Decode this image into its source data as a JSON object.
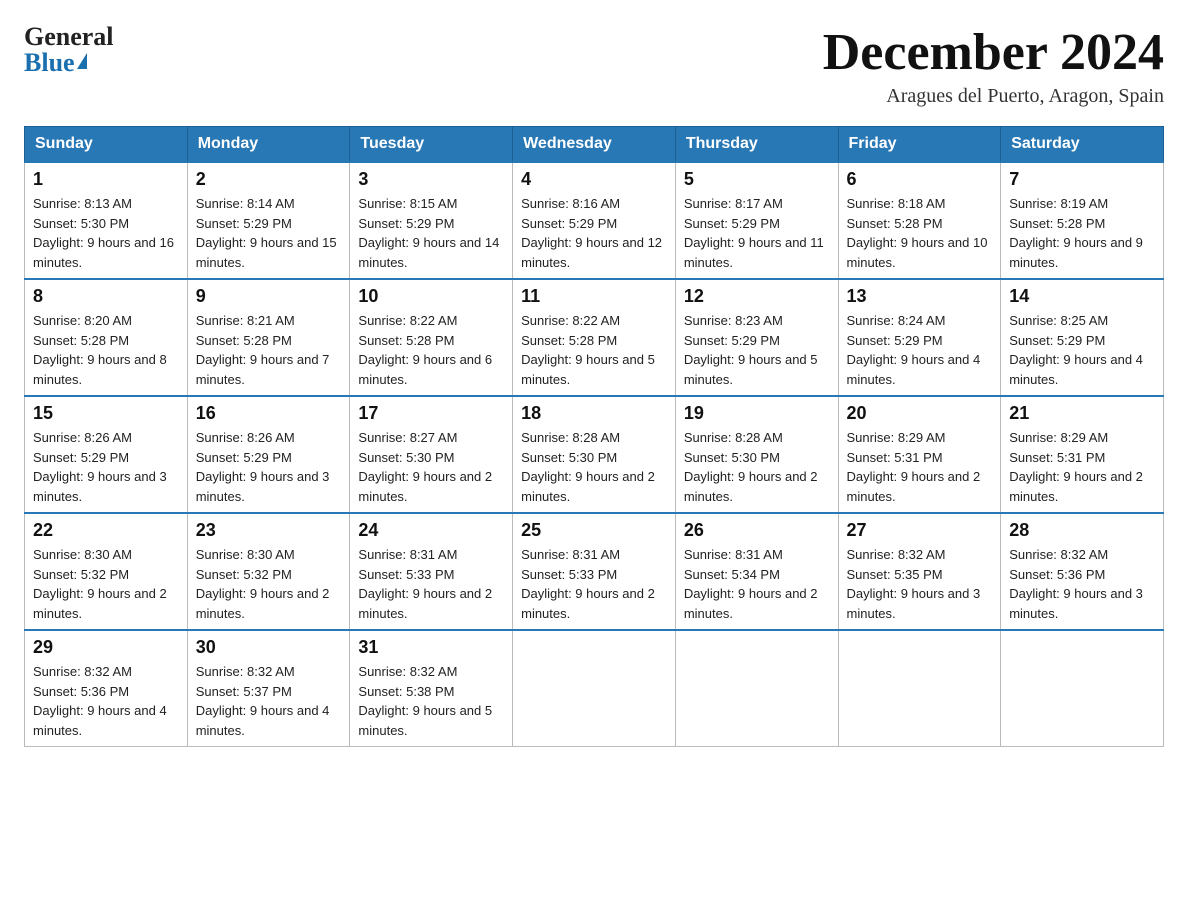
{
  "logo": {
    "general": "General",
    "blue": "Blue"
  },
  "title": {
    "month": "December 2024",
    "location": "Aragues del Puerto, Aragon, Spain"
  },
  "days_of_week": [
    "Sunday",
    "Monday",
    "Tuesday",
    "Wednesday",
    "Thursday",
    "Friday",
    "Saturday"
  ],
  "weeks": [
    [
      {
        "day": "1",
        "sunrise": "8:13 AM",
        "sunset": "5:30 PM",
        "daylight": "9 hours and 16 minutes."
      },
      {
        "day": "2",
        "sunrise": "8:14 AM",
        "sunset": "5:29 PM",
        "daylight": "9 hours and 15 minutes."
      },
      {
        "day": "3",
        "sunrise": "8:15 AM",
        "sunset": "5:29 PM",
        "daylight": "9 hours and 14 minutes."
      },
      {
        "day": "4",
        "sunrise": "8:16 AM",
        "sunset": "5:29 PM",
        "daylight": "9 hours and 12 minutes."
      },
      {
        "day": "5",
        "sunrise": "8:17 AM",
        "sunset": "5:29 PM",
        "daylight": "9 hours and 11 minutes."
      },
      {
        "day": "6",
        "sunrise": "8:18 AM",
        "sunset": "5:28 PM",
        "daylight": "9 hours and 10 minutes."
      },
      {
        "day": "7",
        "sunrise": "8:19 AM",
        "sunset": "5:28 PM",
        "daylight": "9 hours and 9 minutes."
      }
    ],
    [
      {
        "day": "8",
        "sunrise": "8:20 AM",
        "sunset": "5:28 PM",
        "daylight": "9 hours and 8 minutes."
      },
      {
        "day": "9",
        "sunrise": "8:21 AM",
        "sunset": "5:28 PM",
        "daylight": "9 hours and 7 minutes."
      },
      {
        "day": "10",
        "sunrise": "8:22 AM",
        "sunset": "5:28 PM",
        "daylight": "9 hours and 6 minutes."
      },
      {
        "day": "11",
        "sunrise": "8:22 AM",
        "sunset": "5:28 PM",
        "daylight": "9 hours and 5 minutes."
      },
      {
        "day": "12",
        "sunrise": "8:23 AM",
        "sunset": "5:29 PM",
        "daylight": "9 hours and 5 minutes."
      },
      {
        "day": "13",
        "sunrise": "8:24 AM",
        "sunset": "5:29 PM",
        "daylight": "9 hours and 4 minutes."
      },
      {
        "day": "14",
        "sunrise": "8:25 AM",
        "sunset": "5:29 PM",
        "daylight": "9 hours and 4 minutes."
      }
    ],
    [
      {
        "day": "15",
        "sunrise": "8:26 AM",
        "sunset": "5:29 PM",
        "daylight": "9 hours and 3 minutes."
      },
      {
        "day": "16",
        "sunrise": "8:26 AM",
        "sunset": "5:29 PM",
        "daylight": "9 hours and 3 minutes."
      },
      {
        "day": "17",
        "sunrise": "8:27 AM",
        "sunset": "5:30 PM",
        "daylight": "9 hours and 2 minutes."
      },
      {
        "day": "18",
        "sunrise": "8:28 AM",
        "sunset": "5:30 PM",
        "daylight": "9 hours and 2 minutes."
      },
      {
        "day": "19",
        "sunrise": "8:28 AM",
        "sunset": "5:30 PM",
        "daylight": "9 hours and 2 minutes."
      },
      {
        "day": "20",
        "sunrise": "8:29 AM",
        "sunset": "5:31 PM",
        "daylight": "9 hours and 2 minutes."
      },
      {
        "day": "21",
        "sunrise": "8:29 AM",
        "sunset": "5:31 PM",
        "daylight": "9 hours and 2 minutes."
      }
    ],
    [
      {
        "day": "22",
        "sunrise": "8:30 AM",
        "sunset": "5:32 PM",
        "daylight": "9 hours and 2 minutes."
      },
      {
        "day": "23",
        "sunrise": "8:30 AM",
        "sunset": "5:32 PM",
        "daylight": "9 hours and 2 minutes."
      },
      {
        "day": "24",
        "sunrise": "8:31 AM",
        "sunset": "5:33 PM",
        "daylight": "9 hours and 2 minutes."
      },
      {
        "day": "25",
        "sunrise": "8:31 AM",
        "sunset": "5:33 PM",
        "daylight": "9 hours and 2 minutes."
      },
      {
        "day": "26",
        "sunrise": "8:31 AM",
        "sunset": "5:34 PM",
        "daylight": "9 hours and 2 minutes."
      },
      {
        "day": "27",
        "sunrise": "8:32 AM",
        "sunset": "5:35 PM",
        "daylight": "9 hours and 3 minutes."
      },
      {
        "day": "28",
        "sunrise": "8:32 AM",
        "sunset": "5:36 PM",
        "daylight": "9 hours and 3 minutes."
      }
    ],
    [
      {
        "day": "29",
        "sunrise": "8:32 AM",
        "sunset": "5:36 PM",
        "daylight": "9 hours and 4 minutes."
      },
      {
        "day": "30",
        "sunrise": "8:32 AM",
        "sunset": "5:37 PM",
        "daylight": "9 hours and 4 minutes."
      },
      {
        "day": "31",
        "sunrise": "8:32 AM",
        "sunset": "5:38 PM",
        "daylight": "9 hours and 5 minutes."
      },
      null,
      null,
      null,
      null
    ]
  ]
}
